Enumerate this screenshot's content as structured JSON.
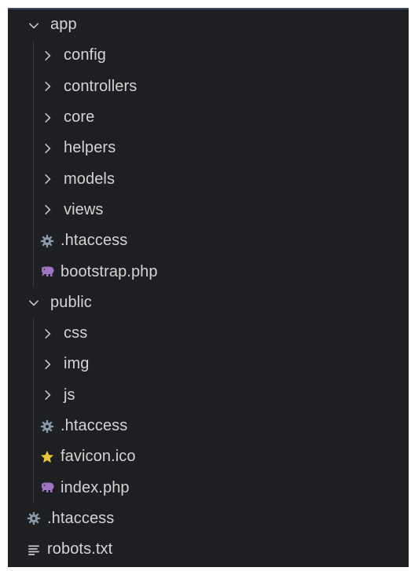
{
  "tree": {
    "items": [
      {
        "label": "app",
        "kind": "folder",
        "expanded": true,
        "depth": 0
      },
      {
        "label": "config",
        "kind": "folder",
        "expanded": false,
        "depth": 1
      },
      {
        "label": "controllers",
        "kind": "folder",
        "expanded": false,
        "depth": 1
      },
      {
        "label": "core",
        "kind": "folder",
        "expanded": false,
        "depth": 1
      },
      {
        "label": "helpers",
        "kind": "folder",
        "expanded": false,
        "depth": 1
      },
      {
        "label": "models",
        "kind": "folder",
        "expanded": false,
        "depth": 1
      },
      {
        "label": "views",
        "kind": "folder",
        "expanded": false,
        "depth": 1
      },
      {
        "label": ".htaccess",
        "kind": "file",
        "icon": "gear-icon",
        "depth": 1
      },
      {
        "label": "bootstrap.php",
        "kind": "file",
        "icon": "php-elephant-icon",
        "depth": 1
      },
      {
        "label": "public",
        "kind": "folder",
        "expanded": true,
        "depth": 0
      },
      {
        "label": "css",
        "kind": "folder",
        "expanded": false,
        "depth": 1
      },
      {
        "label": "img",
        "kind": "folder",
        "expanded": false,
        "depth": 1
      },
      {
        "label": "js",
        "kind": "folder",
        "expanded": false,
        "depth": 1
      },
      {
        "label": ".htaccess",
        "kind": "file",
        "icon": "gear-icon",
        "depth": 1
      },
      {
        "label": "favicon.ico",
        "kind": "file",
        "icon": "star-icon",
        "depth": 1
      },
      {
        "label": "index.php",
        "kind": "file",
        "icon": "php-elephant-icon",
        "depth": 1
      },
      {
        "label": ".htaccess",
        "kind": "file",
        "icon": "gear-icon",
        "depth": 0
      },
      {
        "label": "robots.txt",
        "kind": "file",
        "icon": "text-lines-icon",
        "depth": 0
      }
    ]
  },
  "colors": {
    "background": "#1e1f22",
    "text": "#d4d4d4",
    "gear": "#8a9aab",
    "php": "#a074c4",
    "star": "#e8c63a",
    "text_icon": "#c5c5c5"
  }
}
